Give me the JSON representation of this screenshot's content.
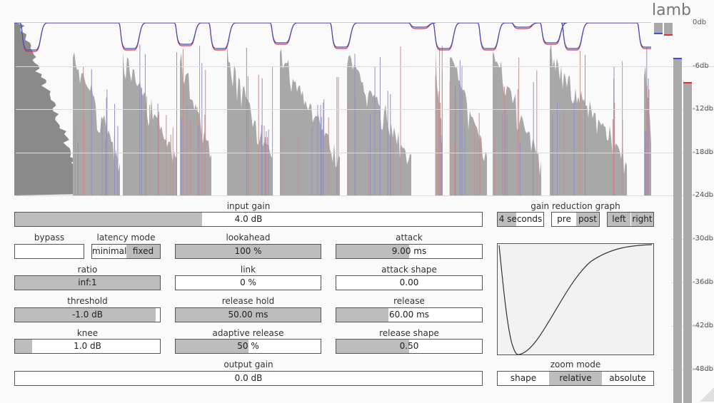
{
  "app": {
    "title": "lamb"
  },
  "scale": {
    "labels": [
      "0db",
      "-6db",
      "-12db",
      "-18db",
      "-24db",
      "-30db",
      "-36db",
      "-42db",
      "-48db"
    ]
  },
  "input_gain": {
    "label": "input gain",
    "value": "4.0 dB",
    "level": 0.4
  },
  "bypass": {
    "label": "bypass"
  },
  "latency_mode": {
    "label": "latency mode",
    "options": [
      "minimal",
      "fixed"
    ],
    "selected": "fixed"
  },
  "lookahead": {
    "label": "lookahead",
    "value": "100 %",
    "level": 1.0
  },
  "attack": {
    "label": "attack",
    "value": "9.00 ms",
    "level": 0.5
  },
  "ratio": {
    "label": "ratio",
    "value": "inf:1",
    "level": 1.0
  },
  "link": {
    "label": "link",
    "value": "0 %",
    "level": 0.0
  },
  "attack_shape": {
    "label": "attack shape",
    "value": "0.00",
    "level": 0.0
  },
  "threshold": {
    "label": "threshold",
    "value": "-1.0 dB",
    "level": 0.97
  },
  "release_hold": {
    "label": "release hold",
    "value": "50.00 ms",
    "level": 1.0
  },
  "release": {
    "label": "release",
    "value": "60.00 ms",
    "level": 0.36
  },
  "knee": {
    "label": "knee",
    "value": "1.0 dB",
    "level": 0.12
  },
  "adaptive_release": {
    "label": "adaptive release",
    "value": "50 %",
    "level": 0.5
  },
  "release_shape": {
    "label": "release shape",
    "value": "0.50",
    "level": 0.5
  },
  "output_gain": {
    "label": "output gain",
    "value": "0.0 dB",
    "level": 0.0
  },
  "gr_graph": {
    "label": "gain reduction graph",
    "duration": "4 seconds",
    "prepost": [
      "pre",
      "post"
    ],
    "prepost_selected": "post",
    "channels": [
      "left",
      "right"
    ],
    "channels_selected": [
      "left"
    ]
  },
  "zoom_mode": {
    "label": "zoom mode",
    "options": [
      "shape",
      "relative",
      "absolute"
    ],
    "selected": "relative"
  },
  "colors": {
    "accent_red": "#e03030",
    "accent_blue": "#4050d0",
    "fill_gray": "#bdbdbd",
    "wave_gray": "#a8a8a8"
  }
}
